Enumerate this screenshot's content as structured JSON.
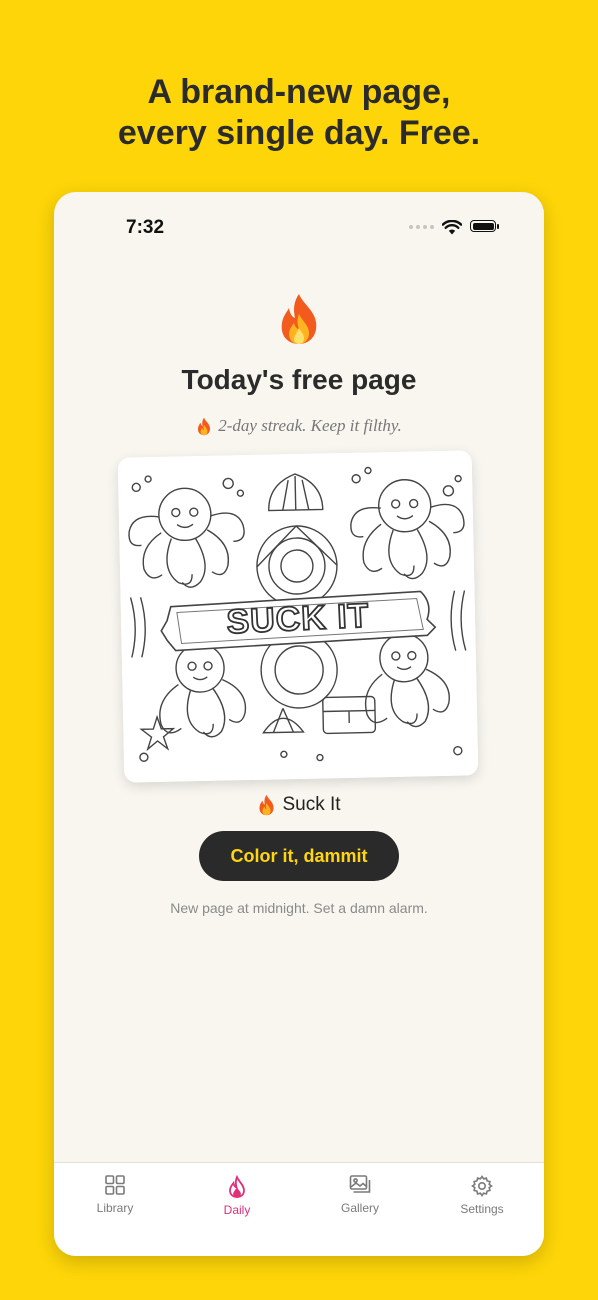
{
  "headline": {
    "line1": "A brand-new page,",
    "line2": "every single day. Free."
  },
  "status_bar": {
    "time": "7:32"
  },
  "daily": {
    "title": "Today's free page",
    "streak_text": "2-day streak. Keep it filthy.",
    "artwork_text": "SUCK IT",
    "page_name": "Suck It",
    "cta_label": "Color it, dammit",
    "note": "New page at midnight. Set a damn alarm."
  },
  "tabs": [
    {
      "label": "Library",
      "icon": "grid-icon",
      "active": false
    },
    {
      "label": "Daily",
      "icon": "flame-icon",
      "active": true
    },
    {
      "label": "Gallery",
      "icon": "gallery-icon",
      "active": false
    },
    {
      "label": "Settings",
      "icon": "gear-icon",
      "active": false
    }
  ],
  "colors": {
    "background": "#FDD508",
    "accent": "#E0307A",
    "button": "#2a2a2a",
    "button_text": "#FFD512"
  }
}
